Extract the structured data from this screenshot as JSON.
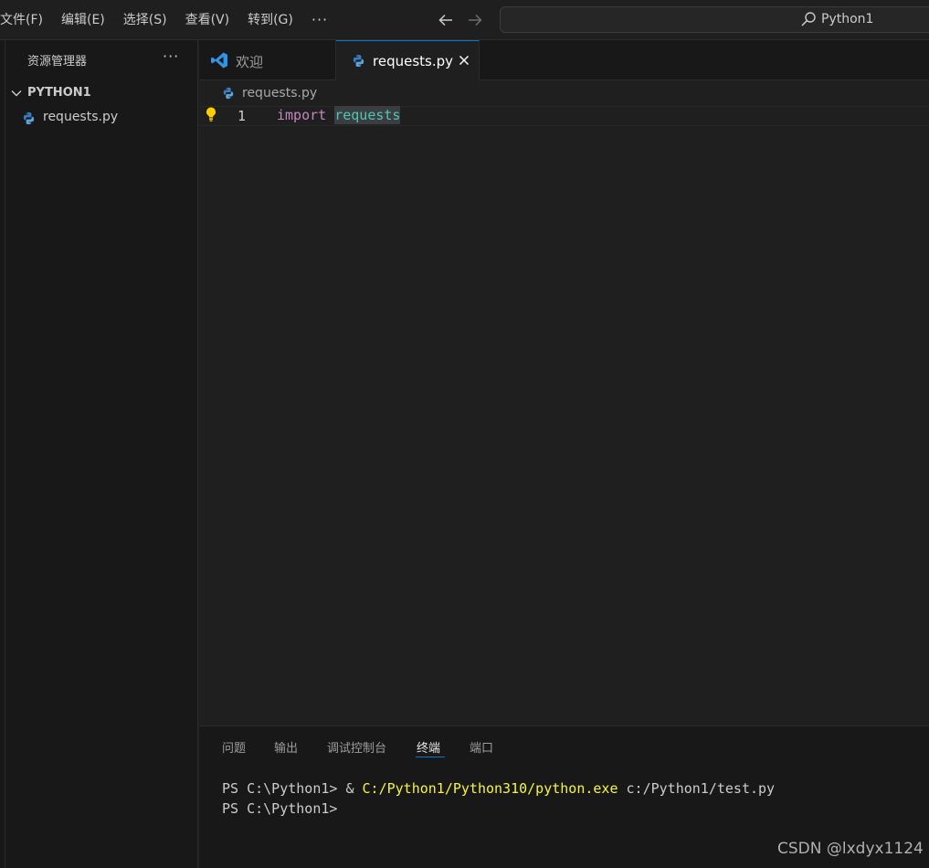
{
  "menu": {
    "items": [
      "文件(F)",
      "编辑(E)",
      "选择(S)",
      "查看(V)",
      "转到(G)"
    ],
    "more": "···"
  },
  "search": {
    "text": "Python1"
  },
  "sidebar": {
    "title": "资源管理器",
    "more": "···",
    "folder": "PYTHON1",
    "files": [
      "requests.py"
    ]
  },
  "tabs": [
    {
      "label": "欢迎",
      "icon": "vscode-logo-icon",
      "active": false
    },
    {
      "label": "requests.py",
      "icon": "python-icon",
      "active": true
    }
  ],
  "breadcrumb": {
    "file": "requests.py"
  },
  "editor": {
    "line_number": "1",
    "keyword": "import",
    "module": "requests"
  },
  "panel": {
    "tabs": [
      "问题",
      "输出",
      "调试控制台",
      "终端",
      "端口"
    ],
    "active_tab": "终端",
    "terminal": {
      "line1_prompt": "PS C:\\Python1> & ",
      "line1_path": "C:/Python1/Python310/python.exe",
      "line1_arg": " c:/Python1/test.py",
      "line2_prompt": "PS C:\\Python1>"
    }
  },
  "watermark": "CSDN @lxdyx1124",
  "colors": {
    "background": "#1f1f1f",
    "sidebar": "#181818",
    "accent": "#0078d4",
    "keyword": "#c586c0",
    "module": "#4ec9b0",
    "terminal_path": "#f5f543"
  }
}
